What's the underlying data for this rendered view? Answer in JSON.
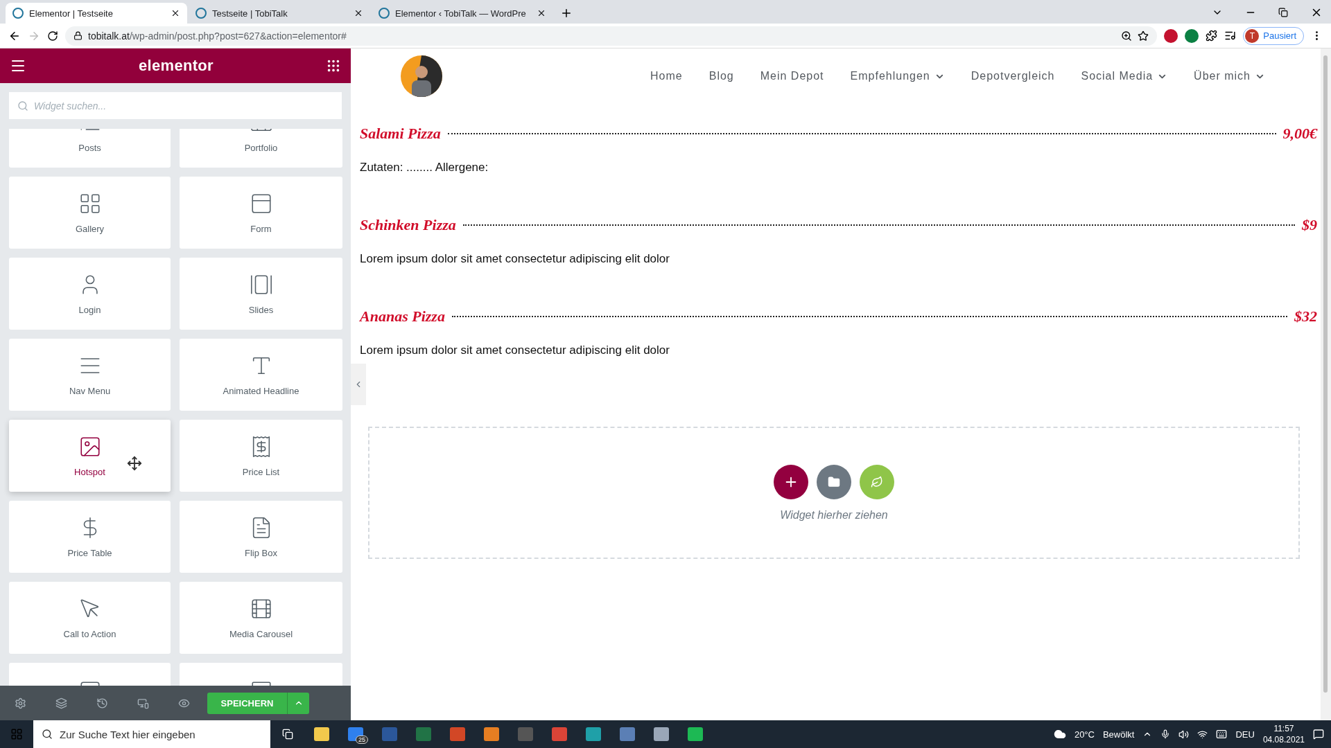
{
  "browser": {
    "tabs": [
      {
        "title": "Elementor | Testseite",
        "selected": true
      },
      {
        "title": "Testseite | TobiTalk",
        "selected": false
      },
      {
        "title": "Elementor ‹ TobiTalk — WordPre",
        "selected": false
      }
    ],
    "url_host": "tobitalk.at",
    "url_path": "/wp-admin/post.php?post=627&action=elementor#",
    "profile_initial": "T",
    "profile_status": "Pausiert"
  },
  "editor": {
    "logo": "elementor",
    "search": {
      "placeholder": "Widget suchen..."
    },
    "widgets": [
      {
        "label": "Posts",
        "selected": false
      },
      {
        "label": "Portfolio",
        "selected": false
      },
      {
        "label": "Gallery",
        "selected": false
      },
      {
        "label": "Form",
        "selected": false
      },
      {
        "label": "Login",
        "selected": false
      },
      {
        "label": "Slides",
        "selected": false
      },
      {
        "label": "Nav Menu",
        "selected": false
      },
      {
        "label": "Animated Headline",
        "selected": false
      },
      {
        "label": "Hotspot",
        "selected": true
      },
      {
        "label": "Price List",
        "selected": false
      },
      {
        "label": "Price Table",
        "selected": false
      },
      {
        "label": "Flip Box",
        "selected": false
      },
      {
        "label": "Call to Action",
        "selected": false
      },
      {
        "label": "Media Carousel",
        "selected": false
      },
      {
        "selected": false
      },
      {
        "selected": false
      }
    ],
    "save_label": "SPEICHERN"
  },
  "preview": {
    "nav": [
      {
        "label": "Home",
        "kind": "link"
      },
      {
        "label": "Blog",
        "kind": "link"
      },
      {
        "label": "Mein Depot",
        "kind": "link"
      },
      {
        "label": "Empfehlungen",
        "kind": "dropdown"
      },
      {
        "label": "Depotvergleich",
        "kind": "link"
      },
      {
        "label": "Social Media",
        "kind": "dropdown"
      },
      {
        "label": "Über mich",
        "kind": "dropdown"
      }
    ],
    "menu": [
      {
        "title": "Salami Pizza",
        "price": "9,00€",
        "description": "Zutaten: ........ Allergene:"
      },
      {
        "title": "Schinken Pizza",
        "price": "$9",
        "description": "Lorem ipsum dolor sit amet consectetur adipiscing elit dolor"
      },
      {
        "title": "Ananas Pizza",
        "price": "$32",
        "description": "Lorem ipsum dolor sit amet consectetur adipiscing elit dolor"
      }
    ],
    "drop_hint": "Widget hierher ziehen"
  },
  "taskbar": {
    "search_placeholder": "Zur Suche Text hier eingeben",
    "mail_badge": "25",
    "weather": "20°C",
    "weather_text": "Bewölkt",
    "language": "DEU",
    "time": "11:57",
    "date": "04.08.2021"
  }
}
